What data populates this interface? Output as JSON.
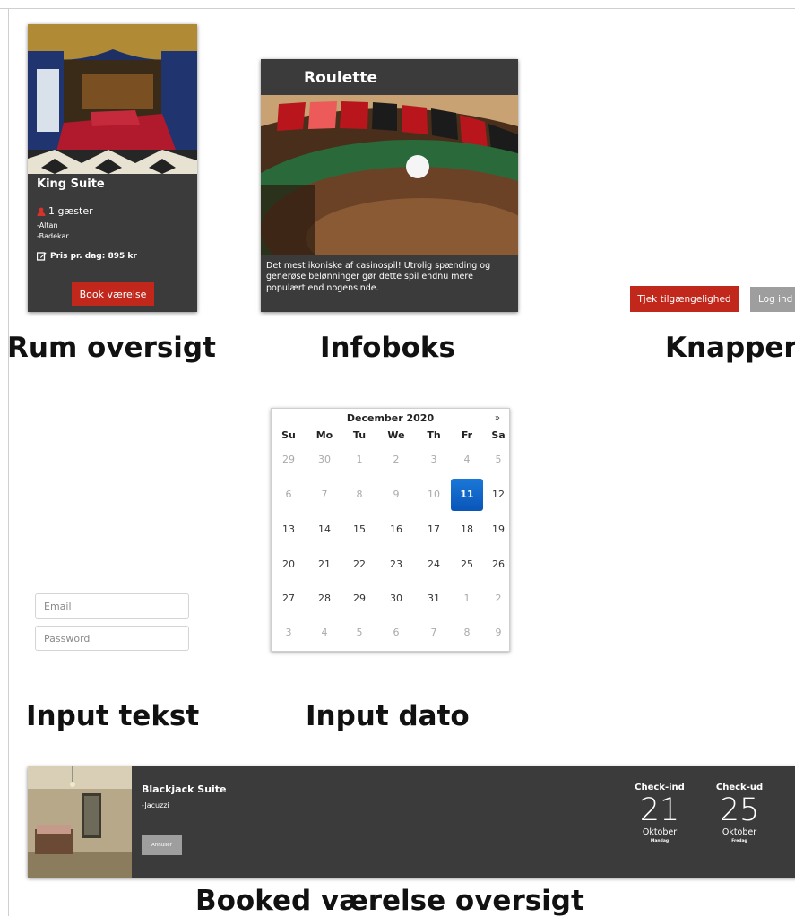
{
  "sections": {
    "rooms": "Rum oversigt",
    "infobox": "Infoboks",
    "buttons": "Knapper",
    "input_text": "Input tekst",
    "input_date": "Input dato",
    "booked": "Booked værelse oversigt"
  },
  "room_card": {
    "name": "King Suite",
    "guests": "1 gæster",
    "features": [
      "-Altan",
      "-Badekar"
    ],
    "price": "Pris pr. dag: 895 kr",
    "book_label": "Book værelse"
  },
  "infobox": {
    "title": "Roulette",
    "text": "Det mest ikoniske af casinospil! Utrolig spænding og generøse belønninger gør dette spil endnu mere populært end nogensinde."
  },
  "buttons": {
    "check_label": "Tjek tilgængelighed",
    "login_label": "Log ind"
  },
  "inputs": {
    "email_placeholder": "Email",
    "password_placeholder": "Password"
  },
  "calendar": {
    "month": "December 2020",
    "next": "»",
    "weekdays": [
      "Su",
      "Mo",
      "Tu",
      "We",
      "Th",
      "Fr",
      "Sa"
    ],
    "weeks": [
      [
        "29",
        "30",
        "1",
        "2",
        "3",
        "4",
        "5"
      ],
      [
        "6",
        "7",
        "8",
        "9",
        "10",
        "11",
        "12"
      ],
      [
        "13",
        "14",
        "15",
        "16",
        "17",
        "18",
        "19"
      ],
      [
        "20",
        "21",
        "22",
        "23",
        "24",
        "25",
        "26"
      ],
      [
        "27",
        "28",
        "29",
        "30",
        "31",
        "1",
        "2"
      ],
      [
        "3",
        "4",
        "5",
        "6",
        "7",
        "8",
        "9"
      ]
    ],
    "selected": "11"
  },
  "booking": {
    "name": "Blackjack Suite",
    "feature": "-Jacuzzi",
    "cancel_label": "Annuller",
    "checkin": {
      "label": "Check-ind",
      "day": "21",
      "month": "Oktober",
      "weekday": "Mandag"
    },
    "checkout": {
      "label": "Check-ud",
      "day": "25",
      "month": "Oktober",
      "weekday": "Fredag"
    }
  },
  "colors": {
    "card_bg": "#3b3b3b",
    "accent_red": "#c1271b",
    "button_gray": "#9e9e9e",
    "selected_blue": "#0a66c8"
  }
}
